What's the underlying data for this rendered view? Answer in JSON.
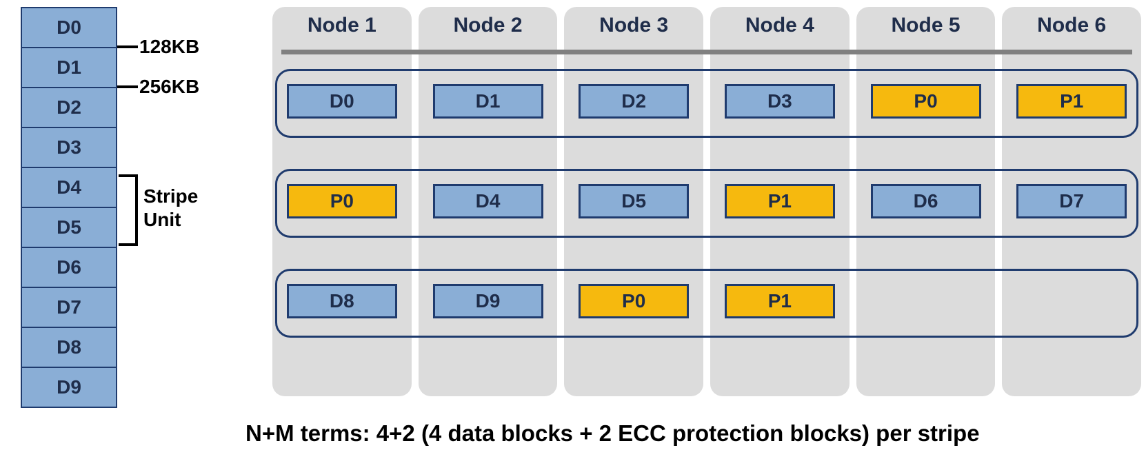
{
  "data_blocks": [
    "D0",
    "D1",
    "D2",
    "D3",
    "D4",
    "D5",
    "D6",
    "D7",
    "D8",
    "D9"
  ],
  "size_markers": {
    "m1": "128KB",
    "m2": "256KB"
  },
  "stripe_unit_label": "Stripe\nUnit",
  "nodes": [
    "Node 1",
    "Node 2",
    "Node 3",
    "Node 4",
    "Node 5",
    "Node 6"
  ],
  "stripes": [
    [
      {
        "t": "D",
        "v": "D0"
      },
      {
        "t": "D",
        "v": "D1"
      },
      {
        "t": "D",
        "v": "D2"
      },
      {
        "t": "D",
        "v": "D3"
      },
      {
        "t": "P",
        "v": "P0"
      },
      {
        "t": "P",
        "v": "P1"
      }
    ],
    [
      {
        "t": "P",
        "v": "P0"
      },
      {
        "t": "D",
        "v": "D4"
      },
      {
        "t": "D",
        "v": "D5"
      },
      {
        "t": "P",
        "v": "P1"
      },
      {
        "t": "D",
        "v": "D6"
      },
      {
        "t": "D",
        "v": "D7"
      }
    ],
    [
      {
        "t": "D",
        "v": "D8"
      },
      {
        "t": "D",
        "v": "D9"
      },
      {
        "t": "P",
        "v": "P0"
      },
      {
        "t": "P",
        "v": "P1"
      },
      {
        "t": "E"
      },
      {
        "t": "E"
      }
    ]
  ],
  "caption": "N+M terms: 4+2 (4 data blocks + 2 ECC protection blocks) per stripe",
  "colors": {
    "data_bg": "#8aaed6",
    "parity_bg": "#f6b90e",
    "node_bg": "#dcdcdc",
    "outline": "#1f3b6e"
  }
}
